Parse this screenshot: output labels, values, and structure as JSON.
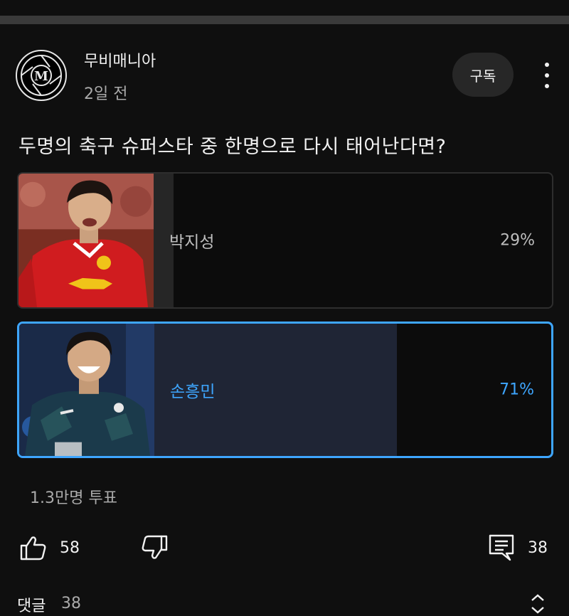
{
  "channel": {
    "name": "무비매니아",
    "posted": "2일 전",
    "avatar_letter": "M"
  },
  "subscribe_label": "구독",
  "poll": {
    "question": "두명의 축구 슈퍼스타 중 한명으로 다시 태어난다면?",
    "options": [
      {
        "label": "박지성",
        "percent_label": "29%",
        "percent": 29,
        "selected": false
      },
      {
        "label": "손흥민",
        "percent_label": "71%",
        "percent": 71,
        "selected": true
      }
    ],
    "vote_count": "1.3만명 투표"
  },
  "actions": {
    "likes": "58",
    "comments": "38"
  },
  "comments_section": {
    "label": "댓글",
    "count": "38"
  },
  "colors": {
    "accent": "#3ea6ff",
    "background": "#0f0f0f",
    "man_utd_red": "#d01c1f",
    "spurs_navy": "#1b3a4b"
  },
  "icons": [
    "more-vert-icon",
    "thumb-up-icon",
    "thumb-down-icon",
    "comment-icon",
    "expand-icon"
  ]
}
